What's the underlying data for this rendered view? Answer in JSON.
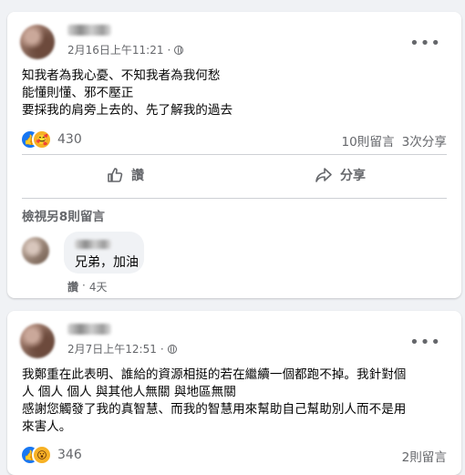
{
  "posts": [
    {
      "timestamp": "2月16日上午11:21",
      "more_label": "•••",
      "lines": [
        "知我者為我心憂、不知我者為我何愁",
        "能懂則懂、邪不壓正",
        "要採我的肩旁上去的、先了解我的過去"
      ],
      "reaction_count": "430",
      "comments_count": "10則留言",
      "shares_count": "3次分享",
      "actions": {
        "like": "讚",
        "share": "分享"
      },
      "more_comments": "檢視另8則留言",
      "comment": {
        "text": "兄弟，加油",
        "like_label": "讚",
        "time": "4天"
      }
    },
    {
      "timestamp": "2月7日上午12:51",
      "more_label": "•••",
      "lines": [
        "我鄭重在此表明、誰給的資源相挺的若在繼續一個都跑不掉。我針對個",
        "人 個人 個人 與其他人無關 與地區無關",
        "感謝您觸發了我的真智慧、而我的智慧用來幫助自己幫助別人而不是用",
        "來害人。"
      ],
      "reaction_count": "346",
      "comments_count": "2則留言"
    }
  ],
  "icons": {
    "like": "like-reaction-icon",
    "care": "care-reaction-icon",
    "wow": "wow-reaction-icon",
    "globe": "globe-icon",
    "thumb": "thumbs-up-icon",
    "share": "share-arrow-icon"
  },
  "colors": {
    "accent": "#1877f2",
    "secondary_text": "#65676b",
    "background": "#f0f2f5"
  }
}
